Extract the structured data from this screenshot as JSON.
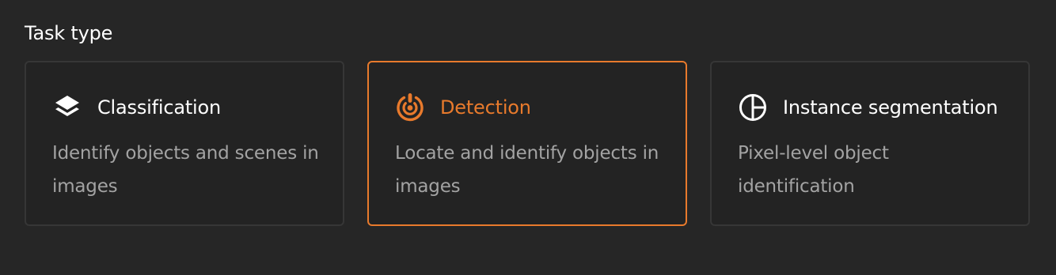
{
  "section": {
    "label": "Task type"
  },
  "accent_color": "#e87a2c",
  "cards": [
    {
      "title": "Classification",
      "description": "Identify objects and scenes in images",
      "icon": "layers-icon",
      "selected": false
    },
    {
      "title": "Detection",
      "description": "Locate and identify objects in images",
      "icon": "target-icon",
      "selected": true
    },
    {
      "title": "Instance segmentation",
      "description": "Pixel-level object identification",
      "icon": "pie-segment-icon",
      "selected": false
    }
  ]
}
